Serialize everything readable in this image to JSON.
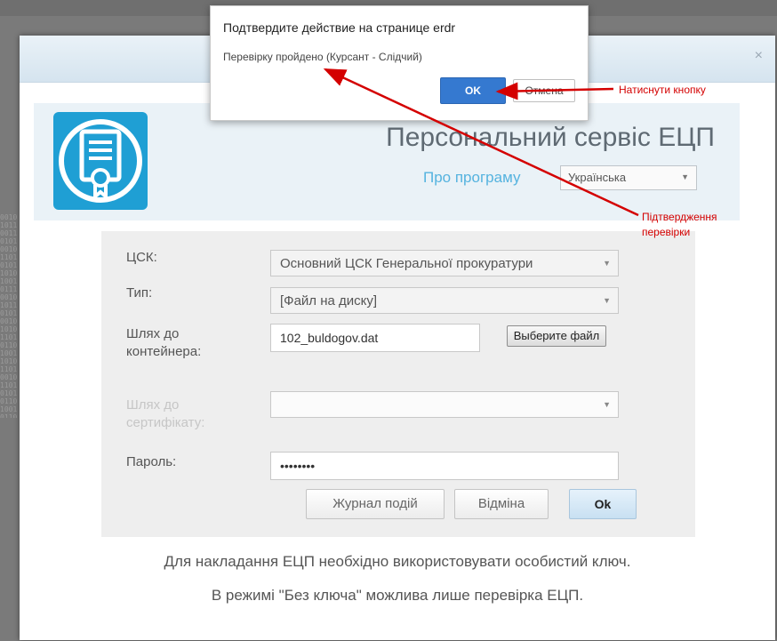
{
  "background": {
    "binary_text": "0010101100110101001011010101101010010111001010110101001010101101011010011010110100101101010101101001011010101011010101011010100101101011010010110101101010010101"
  },
  "dialog": {
    "title": "Подтвердите действие на странице erdr",
    "message": "Перевірку пройдено (Курсант - Слідчий)",
    "ok_label": "OK",
    "cancel_label": "Отмена"
  },
  "modal": {
    "close_glyph": "×"
  },
  "header": {
    "title": "Персональний сервіс ЕЦП",
    "about_link": "Про програму",
    "language": {
      "selected": "Українська"
    }
  },
  "form": {
    "csk": {
      "label": "ЦСК:",
      "value": "Основний ЦСК Генеральної прокуратури"
    },
    "type": {
      "label": "Тип:",
      "value": "[Файл на диску]"
    },
    "container_path": {
      "label": "Шлях до контейнера:",
      "value": "102_buldogov.dat",
      "button": "Выберите файл"
    },
    "cert_path": {
      "label": "Шлях до сертифікату:",
      "value": ""
    },
    "password": {
      "label": "Пароль:",
      "value": "••••••••"
    },
    "buttons": {
      "log": "Журнал подій",
      "cancel": "Відміна",
      "ok": "Ok"
    }
  },
  "notes": {
    "line1": "Для накладання ЕЦП необхідно використовувати особистий ключ.",
    "line2": "В режимі \"Без ключа\" можлива лише перевірка ЕЦП."
  },
  "annotations": {
    "press_button": "Натиснути кнопку",
    "confirmation_line1": "Підтвердження",
    "confirmation_line2": "перевірки"
  },
  "colors": {
    "annotation": "#d40000",
    "primary": "#3579d0",
    "brand_blue": "#1f9fd4",
    "link": "#55b3df"
  }
}
